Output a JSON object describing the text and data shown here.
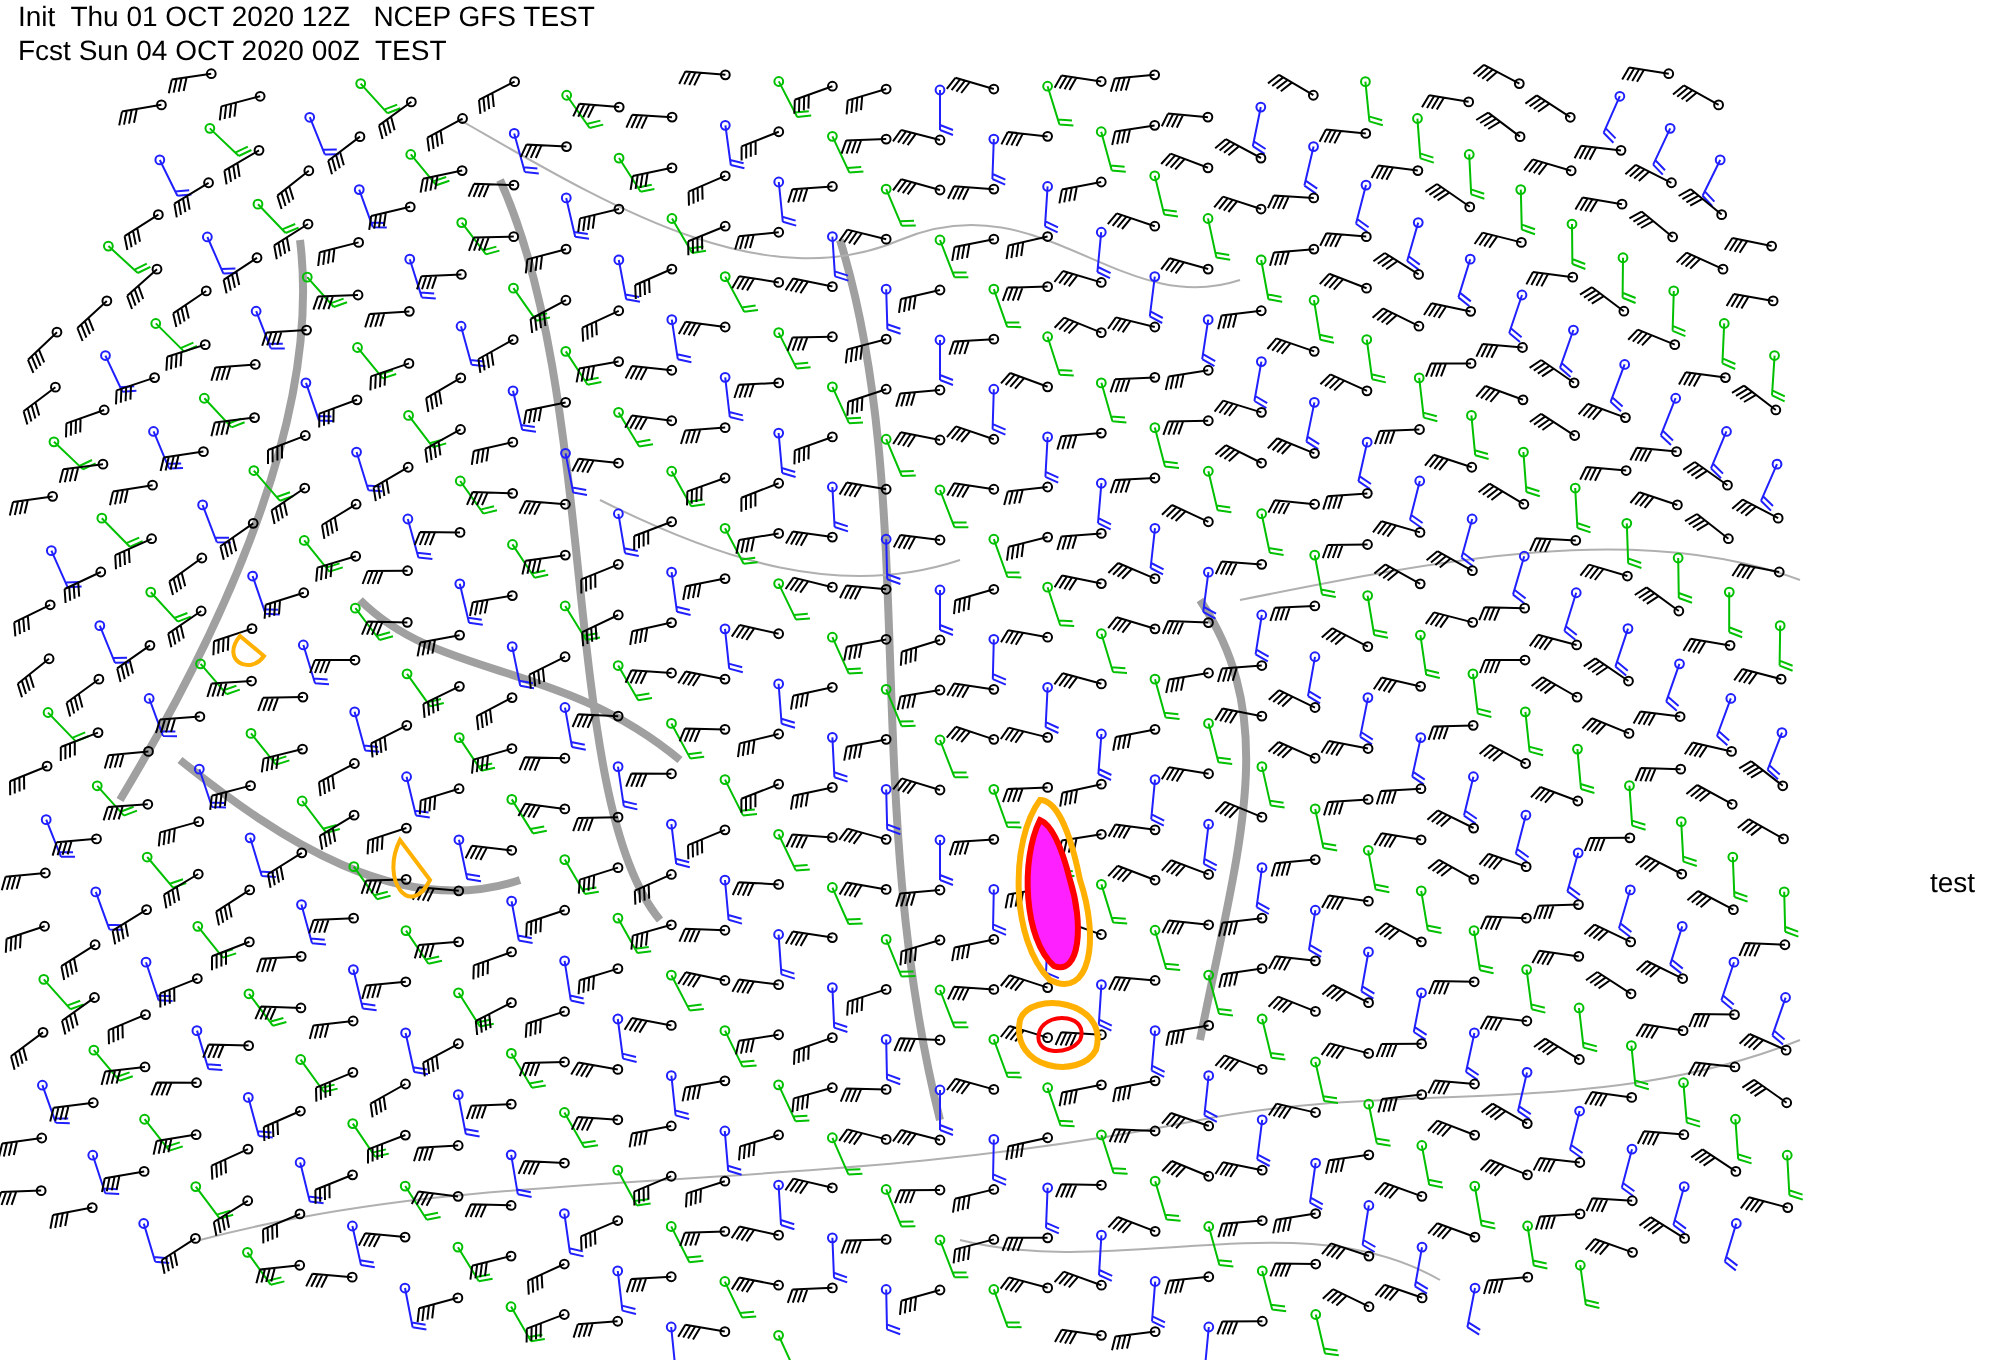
{
  "header": {
    "line_1": "Init  Thu 01 OCT 2020 12Z   NCEP GFS TEST",
    "line_2": "Fcst Sun 04 OCT 2020 00Z  TEST"
  },
  "side_label": "test"
}
